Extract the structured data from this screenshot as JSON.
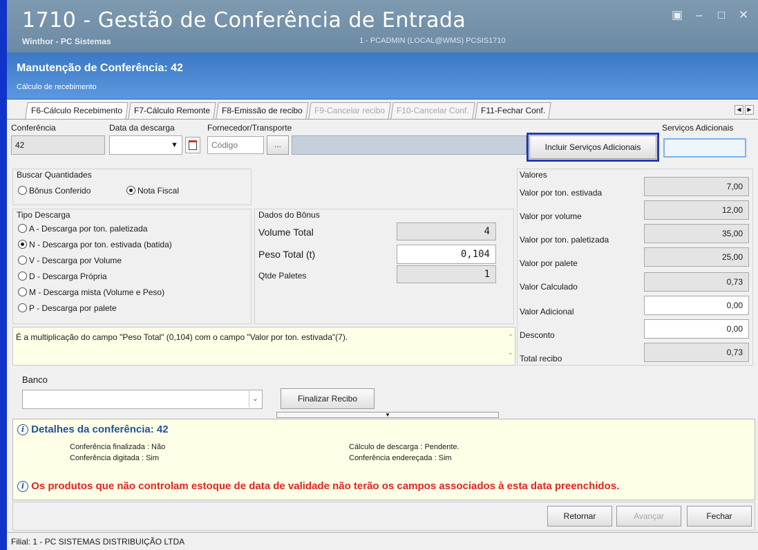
{
  "window": {
    "title": "1710 - Gestão de Conferência de Entrada",
    "subtitle": "Winthor - PC Sistemas",
    "session_info": "1 - PCADMIN (LOCAL@WMS)   PCSIS1710"
  },
  "header": {
    "title": "Manutenção de Conferência: 42",
    "subtitle": "Cálculo de recebimento"
  },
  "tabs": [
    {
      "label": "F6-Cálculo Recebimento"
    },
    {
      "label": "F7-Cálculo Remonte"
    },
    {
      "label": "F8-Emissão de recibo"
    },
    {
      "label": "F9-Cancelar recibo"
    },
    {
      "label": "F10-Cancelar Conf."
    },
    {
      "label": "F11-Fechar Conf."
    }
  ],
  "top_fields": {
    "conferencia_label": "Conferência",
    "conferencia_value": "42",
    "data_descarga_label": "Data da descarga",
    "data_descarga_value": "",
    "fornecedor_label": "Fornecedor/Transporte",
    "fornecedor_placeholder": "Código",
    "ellipsis": "...",
    "incluir_button": "Incluir Serviços Adicionais",
    "servicos_label": "Serviços Adicionais",
    "servicos_value": ""
  },
  "buscar": {
    "title": "Buscar Quantidades",
    "options": [
      "Bônus Conferido",
      "Nota Fiscal"
    ],
    "selected": "Nota Fiscal"
  },
  "tipo_descarga": {
    "title": "Tipo Descarga",
    "options": [
      "A - Descarga por ton. paletizada",
      "N - Descarga por ton. estivada (batida)",
      "V - Descarga por Volume",
      "D - Descarga Própria",
      "M - Descarga mista (Volume e Peso)",
      "P -  Descarga por palete"
    ],
    "selected": "N - Descarga por ton. estivada (batida)"
  },
  "dados_bonus": {
    "title": "Dados do Bônus",
    "volume_label": "Volume Total",
    "volume_value": "4",
    "peso_label": "Peso Total (t)",
    "peso_value": "0,104",
    "paletes_label": "Qtde Paletes",
    "paletes_value": "1"
  },
  "valores": {
    "title": "Valores",
    "rows": [
      {
        "label": "Valor por ton. estivada",
        "value": "7,00"
      },
      {
        "label": "Valor por volume",
        "value": "12,00"
      },
      {
        "label": "Valor por ton. paletizada",
        "value": "35,00"
      },
      {
        "label": "Valor por palete",
        "value": "25,00"
      },
      {
        "label": "Valor Calculado",
        "value": "0,73"
      },
      {
        "label": "Valor Adicional",
        "value": "0,00"
      },
      {
        "label": "Desconto",
        "value": "0,00"
      },
      {
        "label": "Total recibo",
        "value": "0,73"
      }
    ]
  },
  "hint": "É a multiplicação do campo \"Peso Total\" (0,104) com o campo \"Valor por ton. estivada\"(7).",
  "banco": {
    "label": "Banco",
    "value": "",
    "finalizar_button": "Finalizar Recibo"
  },
  "details": {
    "title": "Detalhes da conferência: 42",
    "finalizada": "Conferência finalizada : Não",
    "digitada": "Conferência digitada : Sim",
    "calculo": "Cálculo de descarga : Pendente.",
    "enderecada": "Conferência endereçada : Sim",
    "warning": "Os produtos que não controlam estoque de data de validade não terão os campos associados à esta data preenchidos."
  },
  "buttons": {
    "retornar": "Retornar",
    "avancar": "Avançar",
    "fechar": "Fechar"
  },
  "status": "Filial: 1 - PC SISTEMAS DISTRIBUIÇÃO LTDA",
  "colors": {
    "frame": "#1033c8",
    "header": "#3b78c6",
    "highlight": "#2637b6",
    "warning": "#e0261f",
    "info": "#1d54a0"
  }
}
